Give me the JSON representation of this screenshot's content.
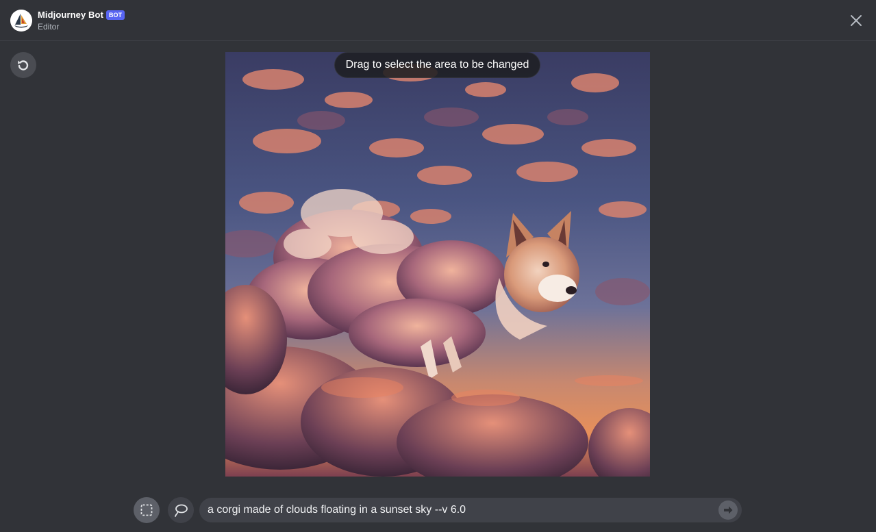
{
  "header": {
    "bot_name": "Midjourney Bot",
    "badge": "BOT",
    "subtitle": "Editor",
    "close_icon": "close-icon"
  },
  "toolbar": {
    "undo_icon": "undo-icon"
  },
  "editor": {
    "tooltip": "Drag to select the area to be changed",
    "image_subject": "corgi made of clouds in sunset sky"
  },
  "bottom": {
    "select_tool_icon": "rectangle-select-icon",
    "lasso_tool_icon": "lasso-icon",
    "prompt_value": "a corgi made of clouds floating in a sunset sky --v 6.0",
    "send_icon": "send-icon"
  },
  "colors": {
    "background": "#313338",
    "accent": "#5865f2",
    "input_bg": "#404249"
  }
}
